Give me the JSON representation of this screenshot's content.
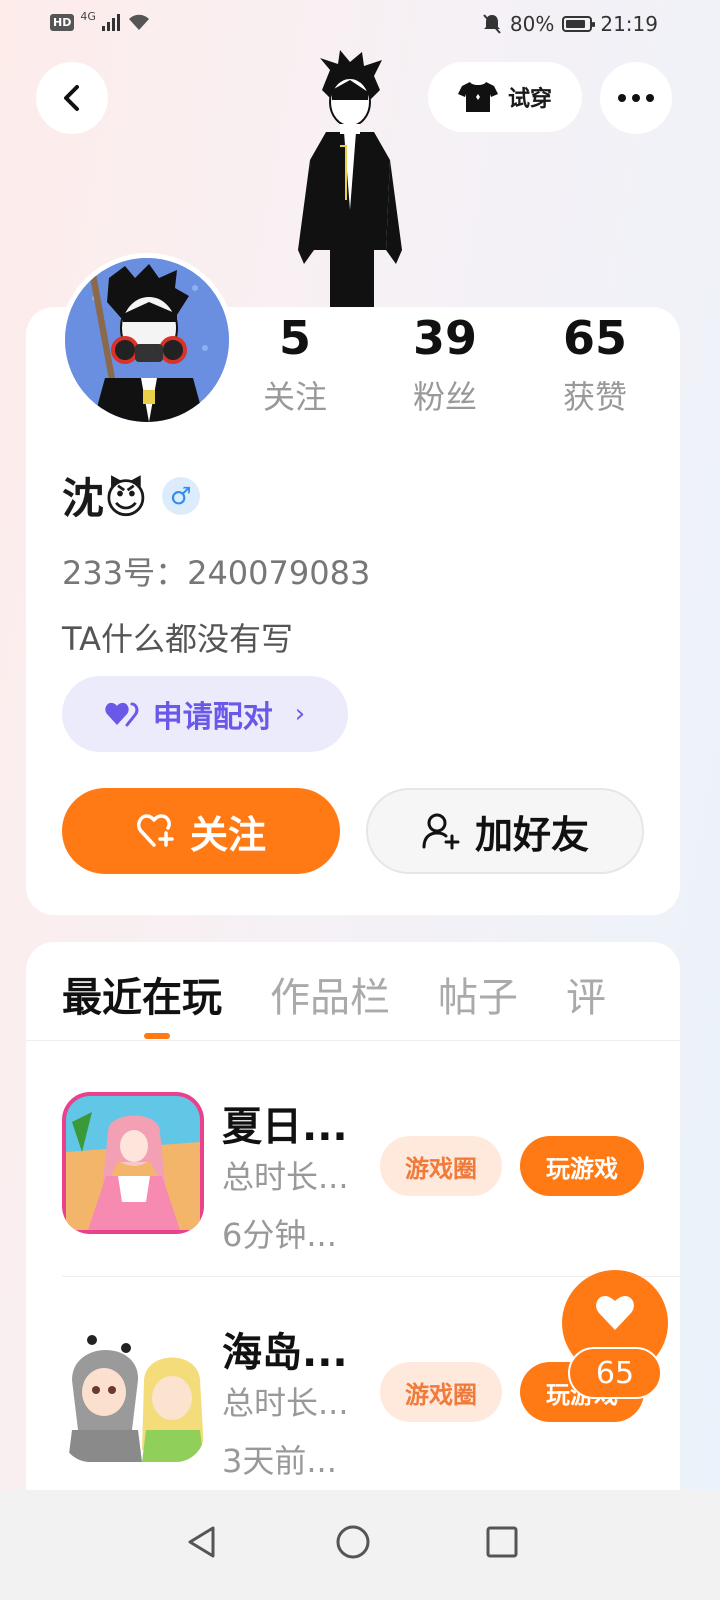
{
  "status_bar": {
    "hd": "HD",
    "network": "4G",
    "battery": "80%",
    "time": "21:19"
  },
  "header": {
    "tryon_label": "试穿"
  },
  "profile": {
    "stats": [
      {
        "value": "5",
        "label": "关注"
      },
      {
        "value": "39",
        "label": "粉丝"
      },
      {
        "value": "65",
        "label": "获赞"
      }
    ],
    "name": "沈😈",
    "gender_symbol": "♂",
    "uid": "233号：240079083",
    "bio": "TA什么都没有写",
    "pair_label": "申请配对",
    "follow_label": "关注",
    "add_friend_label": "加好友"
  },
  "tabs": [
    "最近在玩",
    "作品栏",
    "帖子",
    "评"
  ],
  "games": [
    {
      "title": "夏日...",
      "duration": "总时长...",
      "time": "6分钟...",
      "circle_label": "游戏圈",
      "play_label": "玩游戏"
    },
    {
      "title": "海岛...",
      "duration": "总时长...",
      "time": "3天前...",
      "circle_label": "游戏圈",
      "play_label": "玩游戏"
    }
  ],
  "like_fab": {
    "count": "65"
  },
  "colors": {
    "accent": "#ff7a14",
    "pair": "#6a59e6",
    "pair_bg": "#ecebfc",
    "gender": "#2f8cf0"
  }
}
